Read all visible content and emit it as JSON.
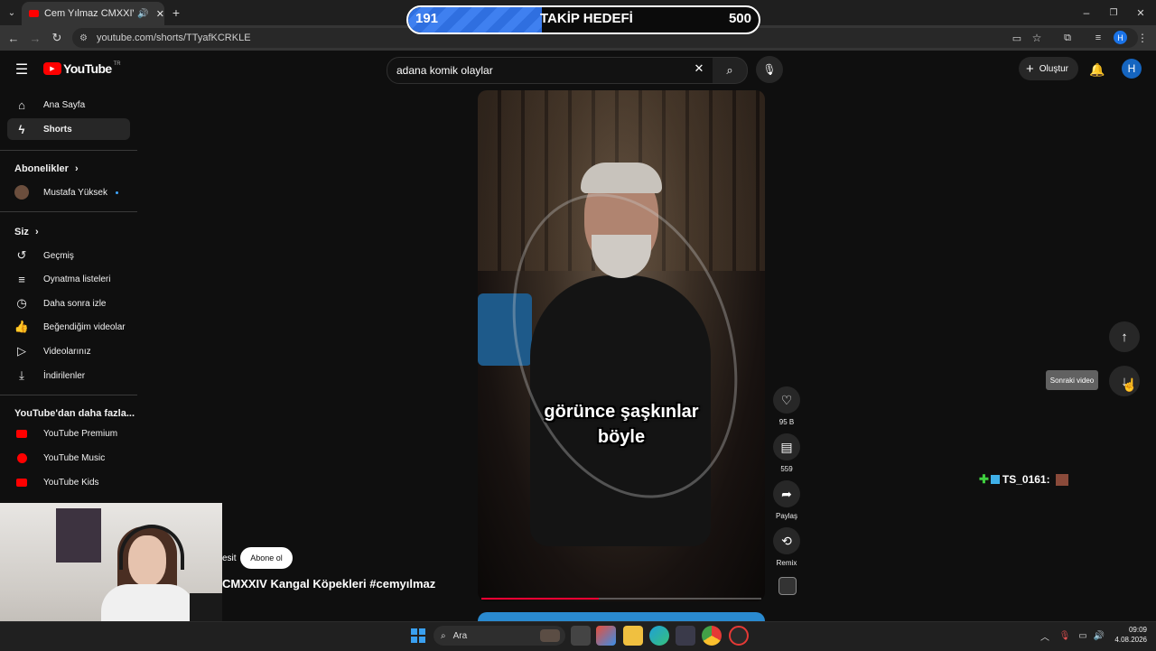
{
  "browser": {
    "tab_title": "Cem Yılmaz CMXXIV Kangal",
    "url": "youtube.com/shorts/TTyafKCRKLE"
  },
  "overlay": {
    "current": "191",
    "label": "TAKİP HEDEFİ",
    "target": "500",
    "progress_fraction": 0.382
  },
  "youtube": {
    "logo_text": "YouTube",
    "region": "TR",
    "search_value": "adana komik olaylar",
    "create_label": "Oluştur",
    "avatar_letter": "H"
  },
  "sidebar": {
    "home": "Ana Sayfa",
    "shorts": "Shorts",
    "subscriptions_title": "Abonelikler",
    "subscription_channel": "Mustafa Yüksek",
    "you_title": "Siz",
    "history": "Geçmiş",
    "playlists": "Oynatma listeleri",
    "watch_later": "Daha sonra izle",
    "liked": "Beğendiğim videolar",
    "your_videos": "Videolarınız",
    "downloads": "İndirilenler",
    "more_title": "YouTube'dan daha fazla...",
    "premium": "YouTube Premium",
    "music": "YouTube Music",
    "kids": "YouTube Kids"
  },
  "short": {
    "caption_line1": "görünce şaşkınlar",
    "caption_line2": "böyle",
    "channel_fragment": "esit",
    "subscribe": "Abone ol",
    "title": "CMXXIV Kangal Köpekleri #cemyılmaz",
    "likes": "95 B",
    "comments": "559",
    "share": "Paylaş",
    "remix": "Remix",
    "progress_fraction": 0.42
  },
  "nav": {
    "tooltip": "Sonraki video"
  },
  "chat": {
    "user": "TS_0161:"
  },
  "taskbar": {
    "search": "Ara",
    "time": "09:09",
    "date": "4.08.2026"
  }
}
